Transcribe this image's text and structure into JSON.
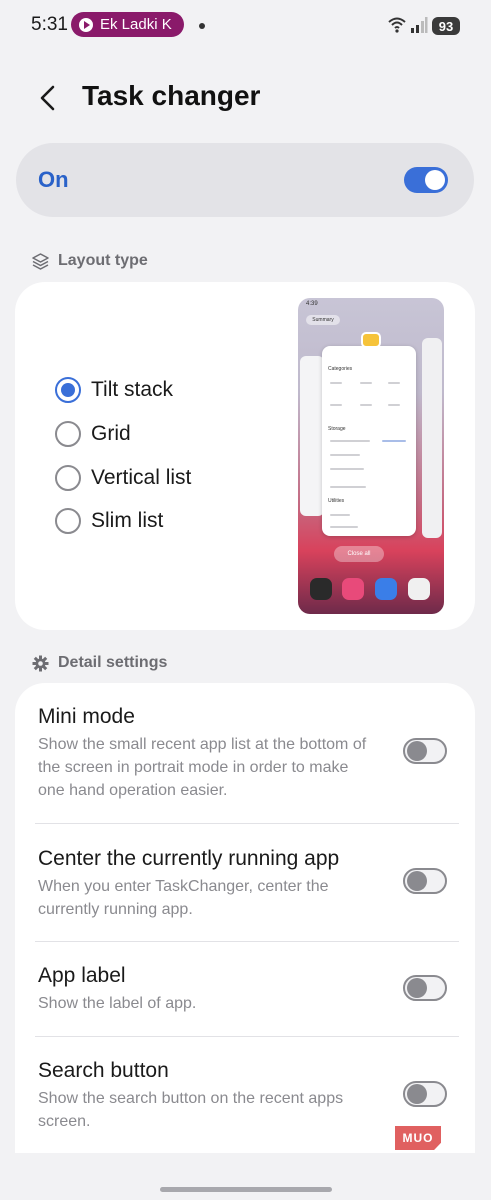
{
  "status_bar": {
    "time": "5:31",
    "media_pill": "Ek Ladki K",
    "battery": "93"
  },
  "header": {
    "title": "Task changer"
  },
  "master_switch": {
    "label": "On",
    "state": true
  },
  "layout_section": {
    "header": "Layout type",
    "options": [
      {
        "label": "Tilt stack",
        "selected": true
      },
      {
        "label": "Grid",
        "selected": false
      },
      {
        "label": "Vertical list",
        "selected": false
      },
      {
        "label": "Slim list",
        "selected": false
      }
    ]
  },
  "preview": {
    "time": "4:39",
    "summary": "Summary",
    "categories": "Categories",
    "storage": "Storage",
    "utilities": "Utilities",
    "close_all": "Close all"
  },
  "detail_section": {
    "header": "Detail settings",
    "items": [
      {
        "title": "Mini mode",
        "description": "Show the small recent app list at the bottom of the screen in portrait mode in order to make one hand operation easier.",
        "enabled": false
      },
      {
        "title": "Center the currently running app",
        "description": "When you enter TaskChanger, center the currently running app.",
        "enabled": false
      },
      {
        "title": "App label",
        "description": "Show the label of app.",
        "enabled": false
      },
      {
        "title": "Search button",
        "description": "Show the search button on the recent apps screen.",
        "enabled": false
      }
    ]
  },
  "watermark": "MUO",
  "colors": {
    "accent": "#3a6fd8",
    "background": "#f2f2f4",
    "card": "#ffffff",
    "pill": "#8a1a6a"
  }
}
